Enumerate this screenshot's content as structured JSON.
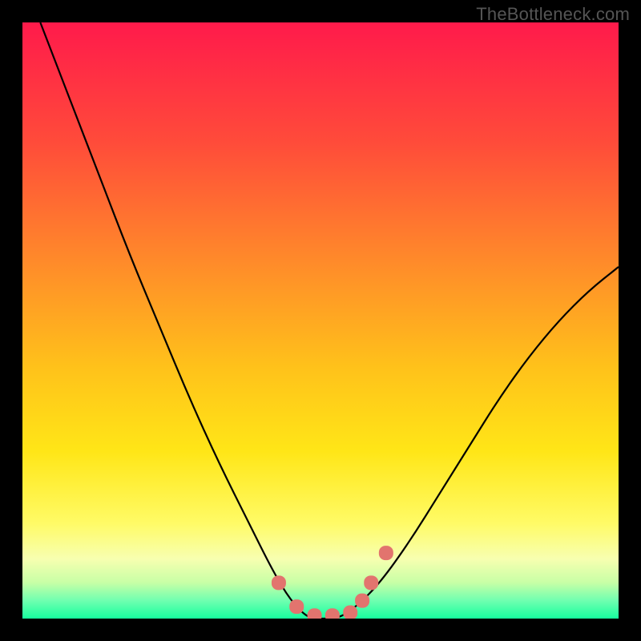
{
  "watermark": "TheBottleneck.com",
  "chart_data": {
    "type": "line",
    "title": "",
    "xlabel": "",
    "ylabel": "",
    "xlim": [
      0,
      100
    ],
    "ylim": [
      0,
      100
    ],
    "grid": false,
    "legend": false,
    "note": "Values are estimated from pixels; axes are unlabeled so units are percentage of plot width/height. y=0 is bottom, y=100 is top.",
    "series": [
      {
        "name": "curve",
        "x": [
          3,
          8,
          13,
          18,
          23,
          28,
          33,
          38,
          42,
          45,
          48,
          50,
          53,
          56,
          60,
          65,
          70,
          75,
          80,
          85,
          90,
          95,
          100
        ],
        "y": [
          100,
          87,
          74,
          61,
          49,
          37,
          26,
          16,
          8,
          3,
          0,
          0,
          0,
          2,
          6,
          13,
          21,
          29,
          37,
          44,
          50,
          55,
          59
        ]
      }
    ],
    "markers": {
      "name": "highlight-dots",
      "x": [
        43,
        46,
        49,
        52,
        55,
        57,
        58.5,
        61
      ],
      "y": [
        6,
        2,
        0.5,
        0.5,
        1,
        3,
        6,
        11
      ]
    },
    "gradient_stops": [
      {
        "offset": 0.0,
        "color": "#ff1a4b"
      },
      {
        "offset": 0.2,
        "color": "#ff4b3a"
      },
      {
        "offset": 0.4,
        "color": "#ff8a2a"
      },
      {
        "offset": 0.58,
        "color": "#ffc21a"
      },
      {
        "offset": 0.72,
        "color": "#ffe617"
      },
      {
        "offset": 0.84,
        "color": "#fffb66"
      },
      {
        "offset": 0.9,
        "color": "#f7ffb0"
      },
      {
        "offset": 0.94,
        "color": "#c7ffa6"
      },
      {
        "offset": 0.97,
        "color": "#6fffb0"
      },
      {
        "offset": 1.0,
        "color": "#17ff9e"
      }
    ],
    "marker_color": "#e2746e"
  }
}
